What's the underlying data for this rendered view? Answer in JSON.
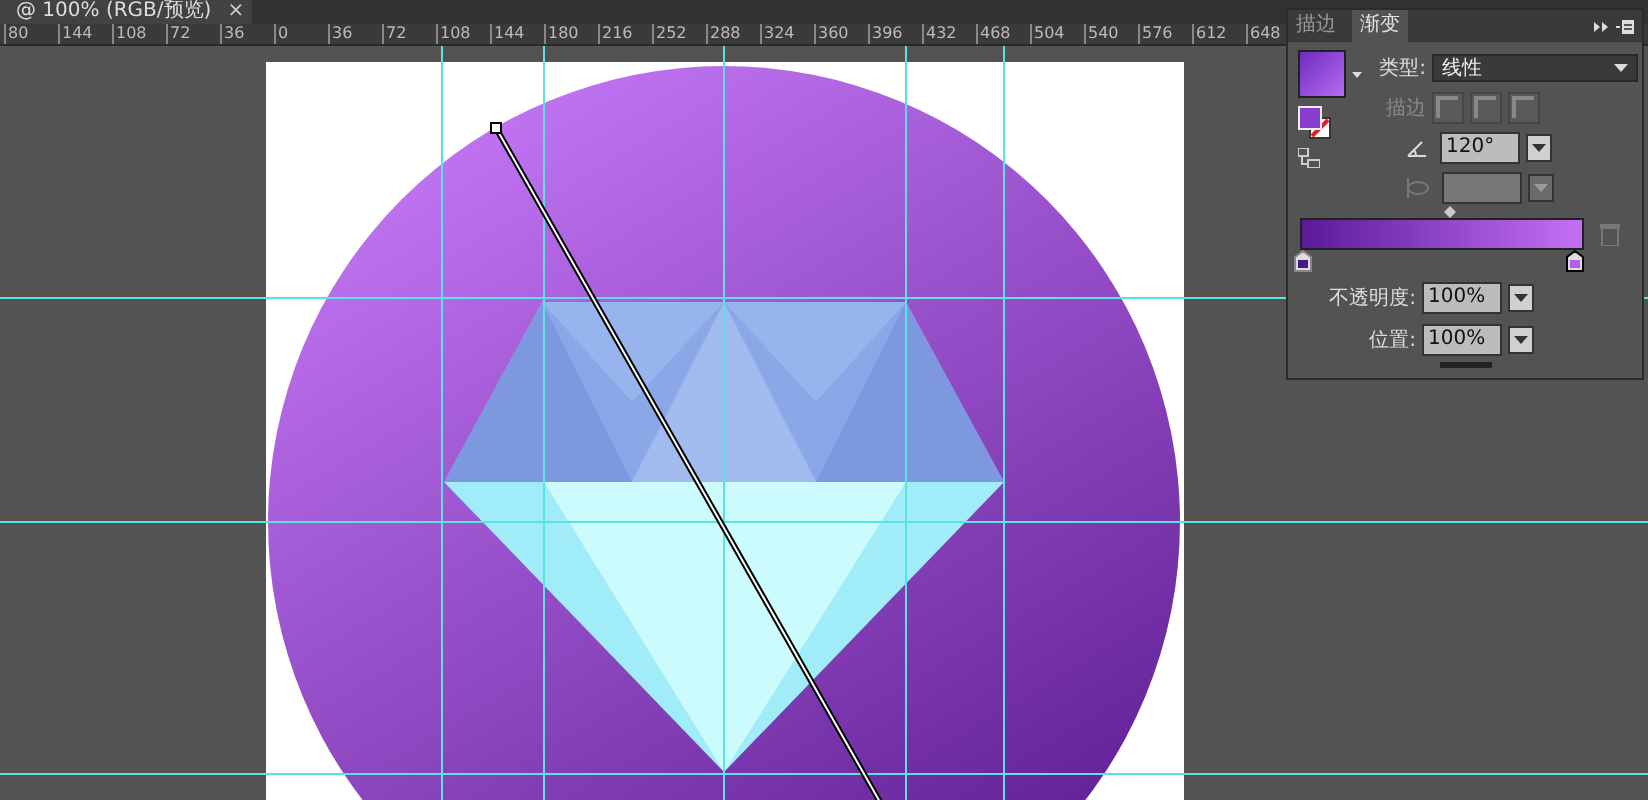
{
  "document_tab": {
    "title": "@ 100% (RGB/预览)",
    "close": "×"
  },
  "ruler": {
    "labels": [
      "80",
      "144",
      "108",
      "72",
      "36",
      "0",
      "36",
      "72",
      "108",
      "144",
      "180",
      "216",
      "252",
      "288",
      "324",
      "360",
      "396",
      "432",
      "468",
      "504",
      "540",
      "576",
      "612",
      "648"
    ]
  },
  "panel": {
    "tabs": [
      {
        "label": "描边",
        "selected": false
      },
      {
        "label": "渐变",
        "selected": true
      }
    ],
    "type": {
      "label": "类型:",
      "value": "线性"
    },
    "stroke": {
      "label": "描边",
      "disabled": true
    },
    "angle": {
      "value": "120°"
    },
    "aspect": {
      "disabled": true
    },
    "stops": [
      {
        "selected": false
      },
      {
        "selected": true
      }
    ],
    "opacity": {
      "label": "不透明度:",
      "value": "100%"
    },
    "location": {
      "label": "位置:",
      "value": "100%"
    }
  }
}
